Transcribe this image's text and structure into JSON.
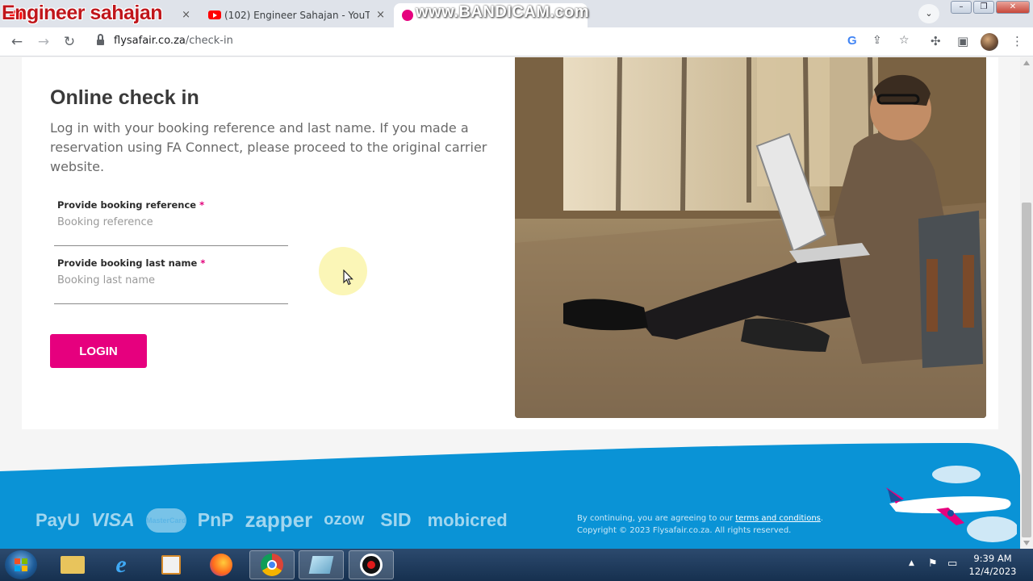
{
  "browser": {
    "tabs": [
      {
        "label": "Engineer sahajan",
        "close": "×"
      },
      {
        "label": "(102) Engineer Sahajan - YouTube",
        "close": "×"
      },
      {
        "label": "www.BANDICAM.com",
        "close": "×"
      }
    ],
    "watermark": "Engineer sahajan",
    "recorder_watermark": "www.BANDICAM.com",
    "url_host": "flysafair.co.za",
    "url_path": "/check-in"
  },
  "page": {
    "title": "Online check in",
    "description": "Log in with your booking reference and last name. If you made a reservation using FA Connect, please proceed to the original carrier website.",
    "fields": {
      "booking_reference": {
        "label": "Provide booking reference",
        "required_mark": "*",
        "placeholder": "Booking reference",
        "value": ""
      },
      "last_name": {
        "label": "Provide booking last name",
        "required_mark": "*",
        "placeholder": "Booking last name",
        "value": ""
      }
    },
    "login_label": "LOGIN"
  },
  "footer": {
    "payment_logos": [
      "PayU",
      "VISA",
      "MasterCard",
      "PnP",
      "zapper",
      "ozow",
      "SID",
      "mobicred"
    ],
    "consent_prefix": "By continuing, you are agreeing to our ",
    "terms_link": "terms and conditions",
    "consent_suffix": ".",
    "copyright": "Copyright © 2023 Flysafair.co.za. All rights reserved.",
    "brand_color": "#0a93d6",
    "accent_color": "#e6007e"
  },
  "taskbar": {
    "time": "9:39 AM",
    "date": "12/4/2023"
  }
}
